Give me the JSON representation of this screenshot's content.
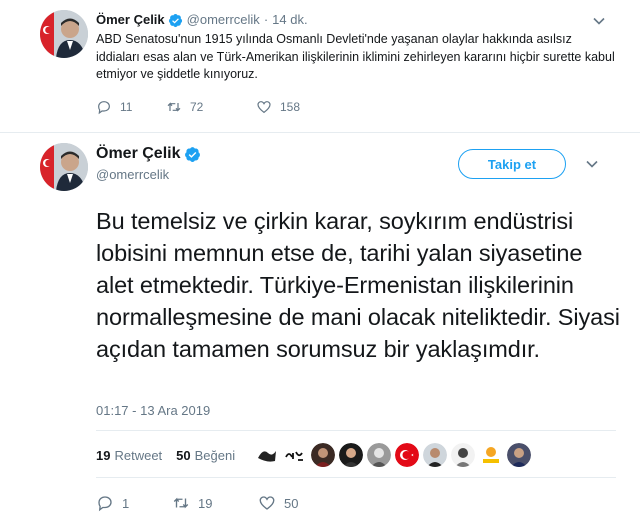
{
  "context_tweet": {
    "name": "Ömer Çelik",
    "handle": "@omerrcelik",
    "separator": "·",
    "time": "14 dk.",
    "text": "ABD Senatosu'nun 1915 yılında Osmanlı Devleti'nde yaşanan olaylar hakkında asılsız iddiaları esas alan ve Türk-Amerikan ilişkilerinin iklimini zehirleyen kararını hiçbir surette kabul etmiyor ve şiddetle kınıyoruz.",
    "replies": "11",
    "retweets": "72",
    "likes": "158"
  },
  "main_tweet": {
    "name": "Ömer Çelik",
    "handle": "@omerrcelik",
    "follow_label": "Takip et",
    "text": "Bu temelsiz ve çirkin karar, soykırım endüstrisi lobisini memnun etse de, tarihi yalan siyasetine alet etmektedir. Türkiye-Ermenistan ilişkilerinin normalleşmesine de mani olacak niteliktedir. Siyasi açıdan tamamen sorumsuz bir yaklaşımdır.",
    "timestamp": "01:17 - 13 Ara 2019",
    "retweet_count": "19",
    "retweet_label": "Retweet",
    "like_count": "50",
    "like_label": "Beğeni",
    "replies": "1",
    "retweets": "19",
    "likes": "50"
  },
  "icons": {
    "verified": "verified-badge-icon",
    "reply": "reply-icon",
    "retweet": "retweet-icon",
    "like": "heart-icon",
    "more": "chevron-down-icon"
  },
  "colors": {
    "accent": "#1da1f2",
    "secondary_text": "#657786",
    "divider": "#e6ecf0"
  }
}
